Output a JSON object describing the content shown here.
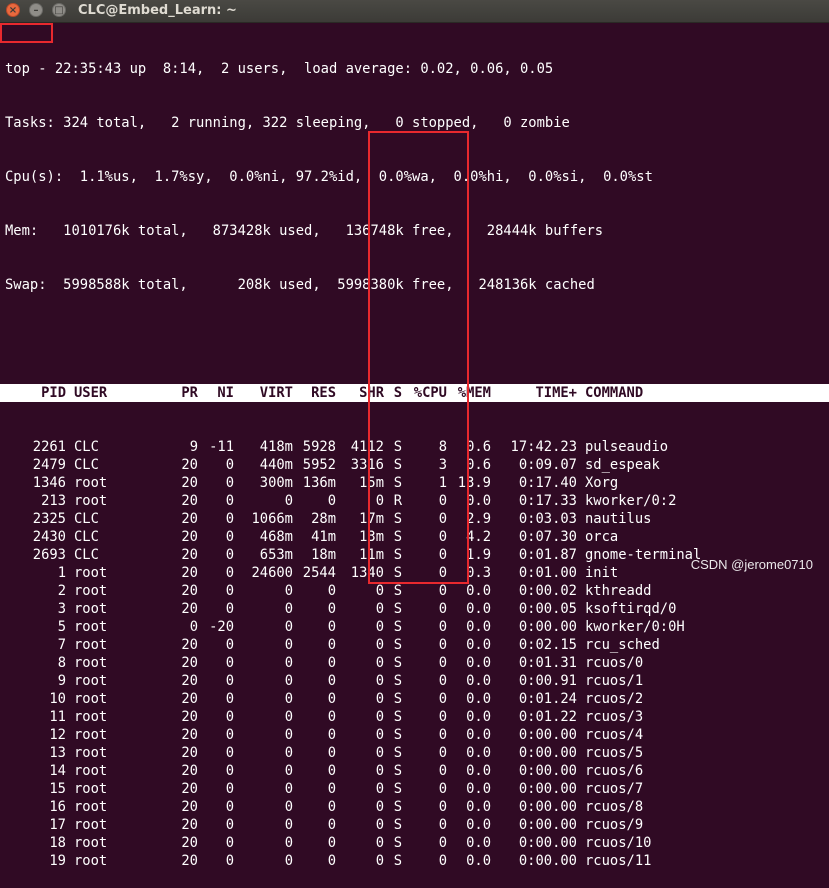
{
  "window": {
    "title": "CLC@Embed_Learn: ~",
    "buttons": {
      "close": "×",
      "minimize": "–",
      "maximize": "□"
    }
  },
  "summary": [
    "top - 22:35:43 up  8:14,  2 users,  load average: 0.02, 0.06, 0.05",
    "Tasks: 324 total,   2 running, 322 sleeping,   0 stopped,   0 zombie",
    "Cpu(s):  1.1%us,  1.7%sy,  0.0%ni, 97.2%id,  0.0%wa,  0.0%hi,  0.0%si,  0.0%st",
    "Mem:   1010176k total,   873428k used,   136748k free,    28444k buffers",
    "Swap:  5998588k total,      208k used,  5998380k free,   248136k cached"
  ],
  "table": {
    "headers": [
      "PID",
      "USER",
      "PR",
      "NI",
      "VIRT",
      "RES",
      "SHR",
      "S",
      "%CPU",
      "%MEM",
      "TIME+",
      "COMMAND"
    ],
    "rows": [
      [
        "2261",
        "CLC",
        "9",
        "-11",
        "418m",
        "5928",
        "4112",
        "S",
        "8",
        "0.6",
        "17:42.23",
        "pulseaudio"
      ],
      [
        "2479",
        "CLC",
        "20",
        "0",
        "440m",
        "5952",
        "3316",
        "S",
        "3",
        "0.6",
        "0:09.07",
        "sd_espeak"
      ],
      [
        "1346",
        "root",
        "20",
        "0",
        "300m",
        "136m",
        "15m",
        "S",
        "1",
        "13.9",
        "0:17.40",
        "Xorg"
      ],
      [
        "213",
        "root",
        "20",
        "0",
        "0",
        "0",
        "0",
        "R",
        "0",
        "0.0",
        "0:17.33",
        "kworker/0:2"
      ],
      [
        "2325",
        "CLC",
        "20",
        "0",
        "1066m",
        "28m",
        "17m",
        "S",
        "0",
        "2.9",
        "0:03.03",
        "nautilus"
      ],
      [
        "2430",
        "CLC",
        "20",
        "0",
        "468m",
        "41m",
        "13m",
        "S",
        "0",
        "4.2",
        "0:07.30",
        "orca"
      ],
      [
        "2693",
        "CLC",
        "20",
        "0",
        "653m",
        "18m",
        "11m",
        "S",
        "0",
        "1.9",
        "0:01.87",
        "gnome-terminal"
      ],
      [
        "1",
        "root",
        "20",
        "0",
        "24600",
        "2544",
        "1340",
        "S",
        "0",
        "0.3",
        "0:01.00",
        "init"
      ],
      [
        "2",
        "root",
        "20",
        "0",
        "0",
        "0",
        "0",
        "S",
        "0",
        "0.0",
        "0:00.02",
        "kthreadd"
      ],
      [
        "3",
        "root",
        "20",
        "0",
        "0",
        "0",
        "0",
        "S",
        "0",
        "0.0",
        "0:00.05",
        "ksoftirqd/0"
      ],
      [
        "5",
        "root",
        "0",
        "-20",
        "0",
        "0",
        "0",
        "S",
        "0",
        "0.0",
        "0:00.00",
        "kworker/0:0H"
      ],
      [
        "7",
        "root",
        "20",
        "0",
        "0",
        "0",
        "0",
        "S",
        "0",
        "0.0",
        "0:02.15",
        "rcu_sched"
      ],
      [
        "8",
        "root",
        "20",
        "0",
        "0",
        "0",
        "0",
        "S",
        "0",
        "0.0",
        "0:01.31",
        "rcuos/0"
      ],
      [
        "9",
        "root",
        "20",
        "0",
        "0",
        "0",
        "0",
        "S",
        "0",
        "0.0",
        "0:00.91",
        "rcuos/1"
      ],
      [
        "10",
        "root",
        "20",
        "0",
        "0",
        "0",
        "0",
        "S",
        "0",
        "0.0",
        "0:01.24",
        "rcuos/2"
      ],
      [
        "11",
        "root",
        "20",
        "0",
        "0",
        "0",
        "0",
        "S",
        "0",
        "0.0",
        "0:01.22",
        "rcuos/3"
      ],
      [
        "12",
        "root",
        "20",
        "0",
        "0",
        "0",
        "0",
        "S",
        "0",
        "0.0",
        "0:00.00",
        "rcuos/4"
      ],
      [
        "13",
        "root",
        "20",
        "0",
        "0",
        "0",
        "0",
        "S",
        "0",
        "0.0",
        "0:00.00",
        "rcuos/5"
      ],
      [
        "14",
        "root",
        "20",
        "0",
        "0",
        "0",
        "0",
        "S",
        "0",
        "0.0",
        "0:00.00",
        "rcuos/6"
      ],
      [
        "15",
        "root",
        "20",
        "0",
        "0",
        "0",
        "0",
        "S",
        "0",
        "0.0",
        "0:00.00",
        "rcuos/7"
      ],
      [
        "16",
        "root",
        "20",
        "0",
        "0",
        "0",
        "0",
        "S",
        "0",
        "0.0",
        "0:00.00",
        "rcuos/8"
      ],
      [
        "17",
        "root",
        "20",
        "0",
        "0",
        "0",
        "0",
        "S",
        "0",
        "0.0",
        "0:00.00",
        "rcuos/9"
      ],
      [
        "18",
        "root",
        "20",
        "0",
        "0",
        "0",
        "0",
        "S",
        "0",
        "0.0",
        "0:00.00",
        "rcuos/10"
      ],
      [
        "19",
        "root",
        "20",
        "0",
        "0",
        "0",
        "0",
        "S",
        "0",
        "0.0",
        "0:00.00",
        "rcuos/11"
      ]
    ]
  },
  "watermark": "CSDN @jerome0710",
  "colors": {
    "terminal_bg": "#300a24",
    "terminal_fg": "#ffffff",
    "highlight_box": "#e8292e",
    "close_button": "#e9693e"
  }
}
